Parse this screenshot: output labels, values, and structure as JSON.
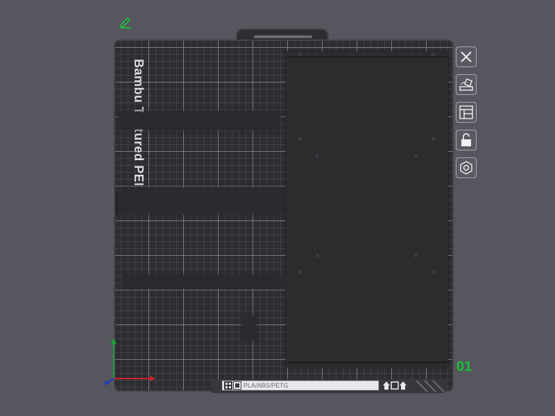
{
  "plate": {
    "label": "Bambu Textured PEI Plate",
    "number": "01",
    "filament": "PLA/ABS/PETG"
  },
  "toolbar": {
    "icons": [
      "close-icon",
      "orient-icon",
      "arrange-icon",
      "lock-icon",
      "settings-icon"
    ]
  },
  "colors": {
    "background": "#56565e",
    "plate": "#2e2e32",
    "accent": "#18c33a",
    "axis_x": "#d0202a",
    "axis_y": "#1aa33a",
    "axis_z": "#1a3ad0"
  }
}
